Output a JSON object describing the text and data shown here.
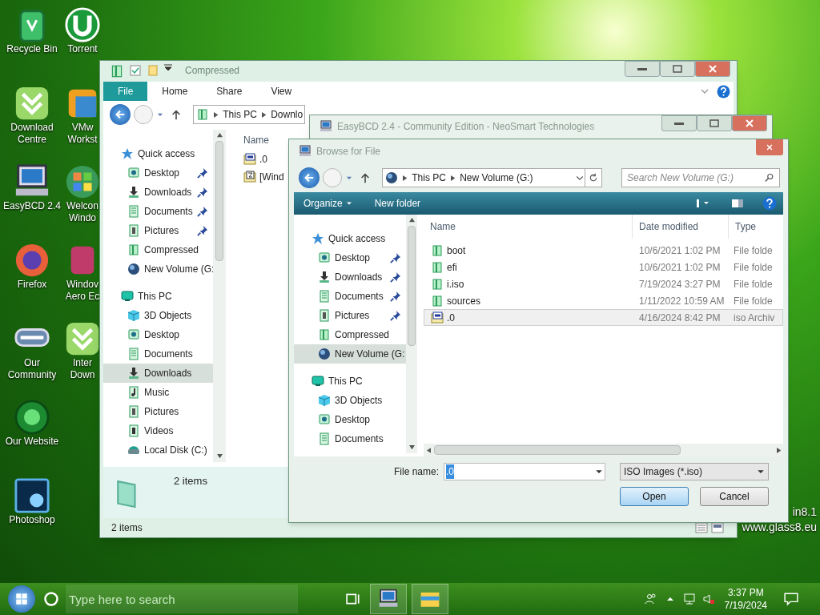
{
  "desktop": {
    "icons_left": [
      {
        "kind": "bin",
        "lines": [
          "Recycle Bin"
        ]
      },
      {
        "kind": "download",
        "lines": [
          "Download",
          "Centre"
        ]
      },
      {
        "kind": "computer",
        "lines": [
          "EasyBCD 2.4"
        ]
      },
      {
        "kind": "browser",
        "lines": [
          "Firefox"
        ]
      },
      {
        "kind": "forum",
        "lines": [
          "Our",
          "Community"
        ]
      },
      {
        "kind": "globe",
        "lines": [
          "Our Website"
        ]
      },
      {
        "kind": "ps",
        "lines": [
          "Photoshop"
        ]
      }
    ],
    "icons_right": [
      {
        "kind": "torrent",
        "lines": [
          "Torrent"
        ]
      },
      {
        "kind": "vm",
        "lines": [
          "VMw",
          "Workst"
        ]
      },
      {
        "kind": "windows",
        "lines": [
          "Welcon",
          "Windo"
        ]
      },
      {
        "kind": "app",
        "lines": [
          "Windov",
          "Aero Ec"
        ]
      },
      {
        "kind": "download",
        "lines": [
          "Inter",
          "Down"
        ]
      }
    ],
    "wallpaper_text": [
      "in8.1",
      "www.glass8.eu"
    ]
  },
  "explorer": {
    "title": "Compressed",
    "ribbon_tabs": [
      {
        "label": "File",
        "selected": true
      },
      {
        "label": "Home",
        "selected": false
      },
      {
        "label": "Share",
        "selected": false
      },
      {
        "label": "View",
        "selected": false
      }
    ],
    "address": [
      "This PC",
      "Downlo"
    ],
    "nav": [
      {
        "label": "Quick access",
        "kind": "star",
        "selected": false,
        "children": [
          {
            "label": "Desktop",
            "kind": "desktop",
            "pinned": true,
            "selected": false
          },
          {
            "label": "Downloads",
            "kind": "download",
            "pinned": true,
            "selected": false
          },
          {
            "label": "Documents",
            "kind": "document",
            "pinned": true,
            "selected": false
          },
          {
            "label": "Pictures",
            "kind": "picture",
            "pinned": true,
            "selected": false
          },
          {
            "label": "Compressed",
            "kind": "folder",
            "selected": false
          },
          {
            "label": "New Volume (G:",
            "kind": "globe",
            "selected": false
          }
        ]
      },
      {
        "label": "This PC",
        "kind": "pc",
        "selected": false,
        "children": [
          {
            "label": "3D Objects",
            "kind": "cube",
            "pinned": false,
            "selected": false
          },
          {
            "label": "Desktop",
            "kind": "desktop",
            "pinned": false,
            "selected": false
          },
          {
            "label": "Documents",
            "kind": "document",
            "pinned": false,
            "selected": false
          },
          {
            "label": "Downloads",
            "kind": "download",
            "pinned": false,
            "selected": true
          },
          {
            "label": "Music",
            "kind": "music",
            "pinned": false,
            "selected": false
          },
          {
            "label": "Pictures",
            "kind": "picture",
            "pinned": false,
            "selected": false
          },
          {
            "label": "Videos",
            "kind": "video",
            "pinned": false,
            "selected": false
          },
          {
            "label": "Local Disk (C:)",
            "kind": "disk",
            "pinned": false,
            "selected": false
          }
        ]
      }
    ],
    "column": "Name",
    "files": [
      {
        "name": ".0",
        "kind": "iso"
      },
      {
        "name": "[Wind",
        "kind": "zip"
      }
    ],
    "details_count": "2 items",
    "status": "2 items"
  },
  "easybcd": {
    "title": "EasyBCD 2.4 - Community Edition - NeoSmart Technologies"
  },
  "dialog": {
    "title": "Browse for File",
    "address": [
      "This PC",
      "New Volume (G:)"
    ],
    "search_placeholder": "Search New Volume (G:)",
    "toolbar": [
      {
        "label": "Organize",
        "menu": true
      },
      {
        "label": "New folder",
        "menu": false
      }
    ],
    "nav": [
      {
        "label": "Quick access",
        "kind": "star",
        "selected": false,
        "children": [
          {
            "label": "Desktop",
            "kind": "desktop",
            "pinned": true,
            "selected": false
          },
          {
            "label": "Downloads",
            "kind": "download",
            "pinned": true,
            "selected": false
          },
          {
            "label": "Documents",
            "kind": "document",
            "pinned": true,
            "selected": false
          },
          {
            "label": "Pictures",
            "kind": "picture",
            "pinned": true,
            "selected": false
          },
          {
            "label": "Compressed",
            "kind": "folder",
            "selected": false
          },
          {
            "label": "New Volume (G:",
            "kind": "globe",
            "selected": true
          }
        ]
      },
      {
        "label": "This PC",
        "kind": "pc",
        "selected": false,
        "children": [
          {
            "label": "3D Objects",
            "kind": "cube",
            "pinned": false,
            "selected": false
          },
          {
            "label": "Desktop",
            "kind": "desktop",
            "pinned": false,
            "selected": false
          },
          {
            "label": "Documents",
            "kind": "document",
            "pinned": false,
            "selected": false
          }
        ]
      }
    ],
    "columns": [
      "Name",
      "Date modified",
      "Type"
    ],
    "rows": [
      {
        "name": "boot",
        "date": "10/6/2021 1:02 PM",
        "type": "File folde",
        "kind": "folder",
        "selected": false
      },
      {
        "name": "efi",
        "date": "10/6/2021 1:02 PM",
        "type": "File folde",
        "kind": "folder",
        "selected": false
      },
      {
        "name": "i.iso",
        "date": "7/19/2024 3:27 PM",
        "type": "File folde",
        "kind": "folder",
        "selected": false
      },
      {
        "name": "sources",
        "date": "1/11/2022 10:59 AM",
        "type": "File folde",
        "kind": "folder",
        "selected": false
      },
      {
        "name": ".0",
        "date": "4/16/2024 8:42 PM",
        "type": "iso Archiv",
        "kind": "iso",
        "selected": true
      }
    ],
    "file_name_label": "File name:",
    "file_name": ".0",
    "filter": "ISO Images (*.iso)",
    "buttons": [
      {
        "label": "Open",
        "default": true
      },
      {
        "label": "Cancel",
        "default": false
      }
    ]
  },
  "taskbar": {
    "search_placeholder": "Type here to search",
    "apps": [
      {
        "kind": "computer"
      },
      {
        "kind": "folder"
      }
    ],
    "time": "3:37 PM",
    "date": "7/19/2024"
  }
}
